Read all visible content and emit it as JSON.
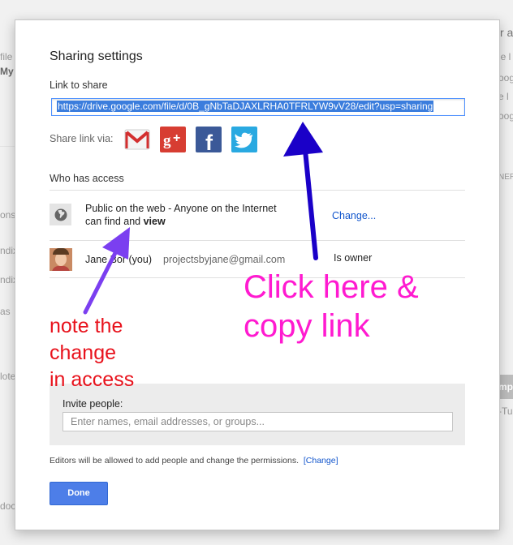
{
  "dialog": {
    "title": "Sharing settings",
    "link_label": "Link to share",
    "link_url": "https://drive.google.com/file/d/0B_gNbTaDJAXLRHA0TFRLYW9vV28/edit?usp=sharing",
    "share_via_label": "Share link via:",
    "share_icons": [
      "gmail-icon",
      "google-plus-icon",
      "facebook-icon",
      "twitter-icon"
    ],
    "who_has_access_label": "Who has access",
    "access_rows": [
      {
        "icon": "globe-icon",
        "text_line1": "Public on the web - Anyone on the Internet",
        "text_line2_prefix": "can find and ",
        "text_line2_bold": "view",
        "action": "Change..."
      },
      {
        "icon": "avatar",
        "name": "Jane Bor (you)",
        "email": "projectsbyjane@gmail.com",
        "role": "Is owner"
      }
    ],
    "invite_label": "Invite people:",
    "invite_placeholder": "Enter names, email addresses, or groups...",
    "editors_note": "Editors will be allowed to add people and change the permissions.",
    "editors_change_link": "[Change]",
    "done_label": "Done"
  },
  "annotations": {
    "pink": [
      "Click here &",
      "copy link"
    ],
    "red": [
      "note the",
      "change",
      "in access"
    ]
  },
  "background": {
    "left": [
      "file",
      "My",
      "ons",
      "ndix",
      "ndix",
      "as",
      "lote",
      "doc"
    ],
    "right": [
      "r a",
      "le l",
      "oog",
      "e l",
      "oog",
      "NER",
      "mpl",
      "-Tu"
    ]
  },
  "colors": {
    "accent": "#4d7ee8",
    "link": "#1155cc",
    "pink_annotation": "#ff1ad0",
    "red_annotation": "#e8121c",
    "arrow_blue": "#1a00c8",
    "arrow_purple": "#7b3ff0"
  }
}
